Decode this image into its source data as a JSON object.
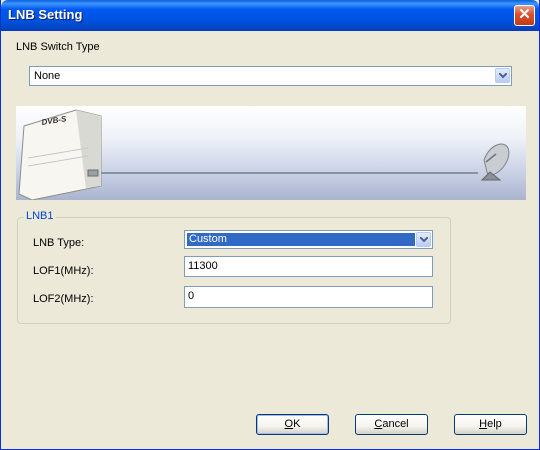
{
  "window": {
    "title": "LNB Setting"
  },
  "switch_type": {
    "label": "LNB Switch Type",
    "value": "None"
  },
  "banner": {
    "device_label": "DVB-S"
  },
  "lnb1": {
    "legend": "LNB1",
    "type_label": "LNB Type:",
    "type_value": "Custom",
    "lof1_label": "LOF1(MHz):",
    "lof1_value": "11300",
    "lof2_label": "LOF2(MHz):",
    "lof2_value": "0"
  },
  "buttons": {
    "ok": {
      "mnemonic": "O",
      "rest": "K"
    },
    "cancel": {
      "mnemonic": "C",
      "rest": "ancel"
    },
    "help": {
      "mnemonic": "H",
      "rest": "elp"
    }
  },
  "colors": {
    "title_bar": "#0054e3",
    "selection": "#316ac5",
    "legend": "#0046d5",
    "dialog_bg": "#ece9d8"
  }
}
